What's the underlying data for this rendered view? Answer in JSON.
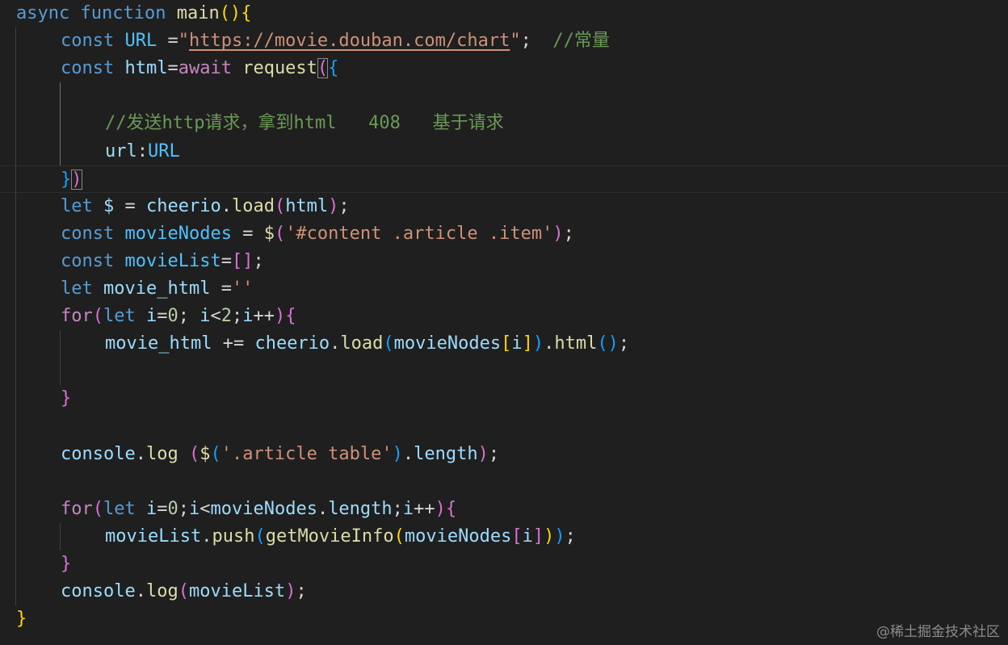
{
  "editor": {
    "lines": [
      {
        "indent": 0,
        "tokens": [
          [
            "async ",
            "kw"
          ],
          [
            "function ",
            "kw"
          ],
          [
            "main",
            "fn"
          ],
          [
            "()",
            "b1"
          ],
          [
            "{",
            "b1"
          ]
        ]
      },
      {
        "indent": 1,
        "tokens": [
          [
            "const ",
            "kw"
          ],
          [
            "URL ",
            "const"
          ],
          [
            "=",
            "plain"
          ],
          [
            "\"",
            "str"
          ],
          [
            "https://movie.douban.com/chart",
            "str url"
          ],
          [
            "\"",
            "str"
          ],
          [
            ";  ",
            "plain"
          ],
          [
            "//常量",
            "cmt"
          ]
        ]
      },
      {
        "indent": 1,
        "tokens": [
          [
            "const ",
            "kw"
          ],
          [
            "html",
            "var"
          ],
          [
            "=",
            "plain"
          ],
          [
            "await ",
            "ctrl"
          ],
          [
            "request",
            "fn"
          ],
          [
            "(",
            "b2 match"
          ],
          [
            "{",
            "b3"
          ]
        ]
      },
      {
        "indent": 1,
        "tokens": []
      },
      {
        "indent": 2,
        "tokens": [
          [
            "//发送http请求，拿到html   408   基于请求",
            "cmt"
          ]
        ]
      },
      {
        "indent": 2,
        "tokens": [
          [
            "url",
            "var"
          ],
          [
            ":",
            "plain"
          ],
          [
            "URL",
            "const"
          ]
        ]
      },
      {
        "indent": 1,
        "current": true,
        "tokens": [
          [
            "}",
            "b3"
          ],
          [
            ")",
            "b2 match"
          ]
        ]
      },
      {
        "indent": 1,
        "tokens": [
          [
            "let ",
            "kw"
          ],
          [
            "$ ",
            "var"
          ],
          [
            "= ",
            "plain"
          ],
          [
            "cheerio",
            "var"
          ],
          [
            ".",
            "plain"
          ],
          [
            "load",
            "fn"
          ],
          [
            "(",
            "b2"
          ],
          [
            "html",
            "var"
          ],
          [
            ")",
            "b2"
          ],
          [
            ";",
            "plain"
          ]
        ]
      },
      {
        "indent": 1,
        "tokens": [
          [
            "const ",
            "kw"
          ],
          [
            "movieNodes ",
            "const"
          ],
          [
            "= ",
            "plain"
          ],
          [
            "$",
            "fn"
          ],
          [
            "(",
            "b2"
          ],
          [
            "'#content .article .item'",
            "str"
          ],
          [
            ")",
            "b2"
          ],
          [
            ";",
            "plain"
          ]
        ]
      },
      {
        "indent": 1,
        "tokens": [
          [
            "const ",
            "kw"
          ],
          [
            "movieList",
            "const"
          ],
          [
            "=",
            "plain"
          ],
          [
            "[]",
            "b2"
          ],
          [
            ";",
            "plain"
          ]
        ]
      },
      {
        "indent": 1,
        "tokens": [
          [
            "let ",
            "kw"
          ],
          [
            "movie_html ",
            "var"
          ],
          [
            "=",
            "plain"
          ],
          [
            "''",
            "str"
          ]
        ]
      },
      {
        "indent": 1,
        "tokens": [
          [
            "for",
            "ctrl"
          ],
          [
            "(",
            "b2"
          ],
          [
            "let ",
            "kw"
          ],
          [
            "i",
            "var"
          ],
          [
            "=",
            "plain"
          ],
          [
            "0",
            "num"
          ],
          [
            "; ",
            "plain"
          ],
          [
            "i",
            "var"
          ],
          [
            "<",
            "plain"
          ],
          [
            "2",
            "num"
          ],
          [
            ";",
            "plain"
          ],
          [
            "i",
            "var"
          ],
          [
            "++",
            "plain"
          ],
          [
            ")",
            "b2"
          ],
          [
            "{",
            "b2"
          ]
        ]
      },
      {
        "indent": 2,
        "tokens": [
          [
            "movie_html ",
            "var"
          ],
          [
            "+= ",
            "plain"
          ],
          [
            "cheerio",
            "var"
          ],
          [
            ".",
            "plain"
          ],
          [
            "load",
            "fn"
          ],
          [
            "(",
            "b3"
          ],
          [
            "movieNodes",
            "var"
          ],
          [
            "[",
            "b1"
          ],
          [
            "i",
            "var"
          ],
          [
            "]",
            "b1"
          ],
          [
            ")",
            "b3"
          ],
          [
            ".",
            "plain"
          ],
          [
            "html",
            "fn"
          ],
          [
            "()",
            "b3"
          ],
          [
            ";",
            "plain"
          ]
        ]
      },
      {
        "indent": 1,
        "tokens": []
      },
      {
        "indent": 1,
        "tokens": [
          [
            "}",
            "b2"
          ]
        ]
      },
      {
        "indent": 0,
        "tokens": []
      },
      {
        "indent": 1,
        "tokens": [
          [
            "console",
            "var"
          ],
          [
            ".",
            "plain"
          ],
          [
            "log ",
            "fn"
          ],
          [
            "(",
            "b2"
          ],
          [
            "$",
            "fn"
          ],
          [
            "(",
            "b3"
          ],
          [
            "'.article table'",
            "str"
          ],
          [
            ")",
            "b3"
          ],
          [
            ".",
            "plain"
          ],
          [
            "length",
            "var"
          ],
          [
            ")",
            "b2"
          ],
          [
            ";",
            "plain"
          ]
        ]
      },
      {
        "indent": 0,
        "tokens": []
      },
      {
        "indent": 1,
        "tokens": [
          [
            "for",
            "ctrl"
          ],
          [
            "(",
            "b2"
          ],
          [
            "let ",
            "kw"
          ],
          [
            "i",
            "var"
          ],
          [
            "=",
            "plain"
          ],
          [
            "0",
            "num"
          ],
          [
            ";",
            "plain"
          ],
          [
            "i",
            "var"
          ],
          [
            "<",
            "plain"
          ],
          [
            "movieNodes",
            "var"
          ],
          [
            ".",
            "plain"
          ],
          [
            "length",
            "var"
          ],
          [
            ";",
            "plain"
          ],
          [
            "i",
            "var"
          ],
          [
            "++",
            "plain"
          ],
          [
            ")",
            "b2"
          ],
          [
            "{",
            "b2"
          ]
        ]
      },
      {
        "indent": 2,
        "tokens": [
          [
            "movieList",
            "var"
          ],
          [
            ".",
            "plain"
          ],
          [
            "push",
            "fn"
          ],
          [
            "(",
            "b3"
          ],
          [
            "getMovieInfo",
            "fn"
          ],
          [
            "(",
            "b1"
          ],
          [
            "movieNodes",
            "var"
          ],
          [
            "[",
            "b2"
          ],
          [
            "i",
            "var"
          ],
          [
            "]",
            "b2"
          ],
          [
            ")",
            "b1"
          ],
          [
            ")",
            "b3"
          ],
          [
            ";",
            "plain"
          ]
        ]
      },
      {
        "indent": 1,
        "tokens": [
          [
            "}",
            "b2"
          ]
        ]
      },
      {
        "indent": 1,
        "tokens": [
          [
            "console",
            "var"
          ],
          [
            ".",
            "plain"
          ],
          [
            "log",
            "fn"
          ],
          [
            "(",
            "b2"
          ],
          [
            "movieList",
            "var"
          ],
          [
            ")",
            "b2"
          ],
          [
            ";",
            "plain"
          ]
        ]
      },
      {
        "indent": 0,
        "tokens": [
          [
            "}",
            "b1"
          ]
        ]
      }
    ]
  },
  "watermark": "@稀土掘金技术社区"
}
